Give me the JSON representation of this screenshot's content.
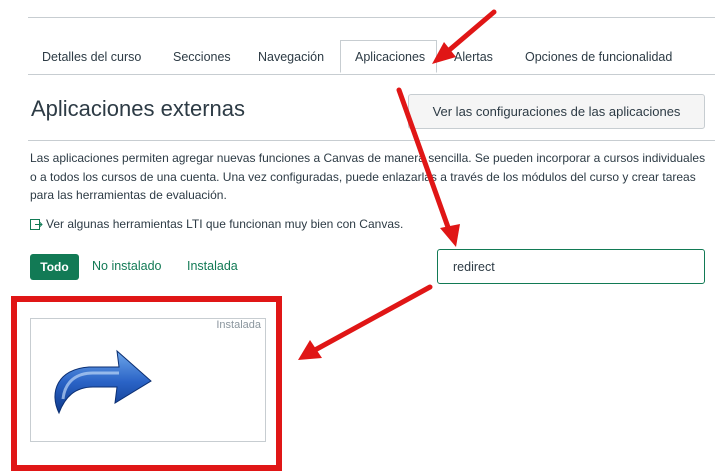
{
  "tabs": [
    {
      "label": "Detalles del curso",
      "active": false
    },
    {
      "label": "Secciones",
      "active": false
    },
    {
      "label": "Navegación",
      "active": false
    },
    {
      "label": "Aplicaciones",
      "active": true
    },
    {
      "label": "Alertas",
      "active": false
    },
    {
      "label": "Opciones de funcionalidad",
      "active": false
    }
  ],
  "header": {
    "title": "Aplicaciones externas",
    "config_button": "Ver las configuraciones de las aplicaciones"
  },
  "description": "Las aplicaciones permiten agregar nuevas funciones a Canvas de manera sencilla. Se pueden incorporar a cursos individuales o a todos los cursos de una cuenta. Una vez configuradas, puede enlazarlas a través de los módulos del curso y crear tareas para las herramientas de evaluación.",
  "lti_link": "Ver algunas herramientas LTI que funcionan muy bien con Canvas.",
  "filters": {
    "all": "Todo",
    "not_installed": "No instalado",
    "installed": "Instalada"
  },
  "search": {
    "value": "redirect"
  },
  "app_card": {
    "badge": "Instalada",
    "icon": "redirect-arrow-icon"
  },
  "colors": {
    "accent": "#127a55",
    "annotation": "#e01616"
  }
}
